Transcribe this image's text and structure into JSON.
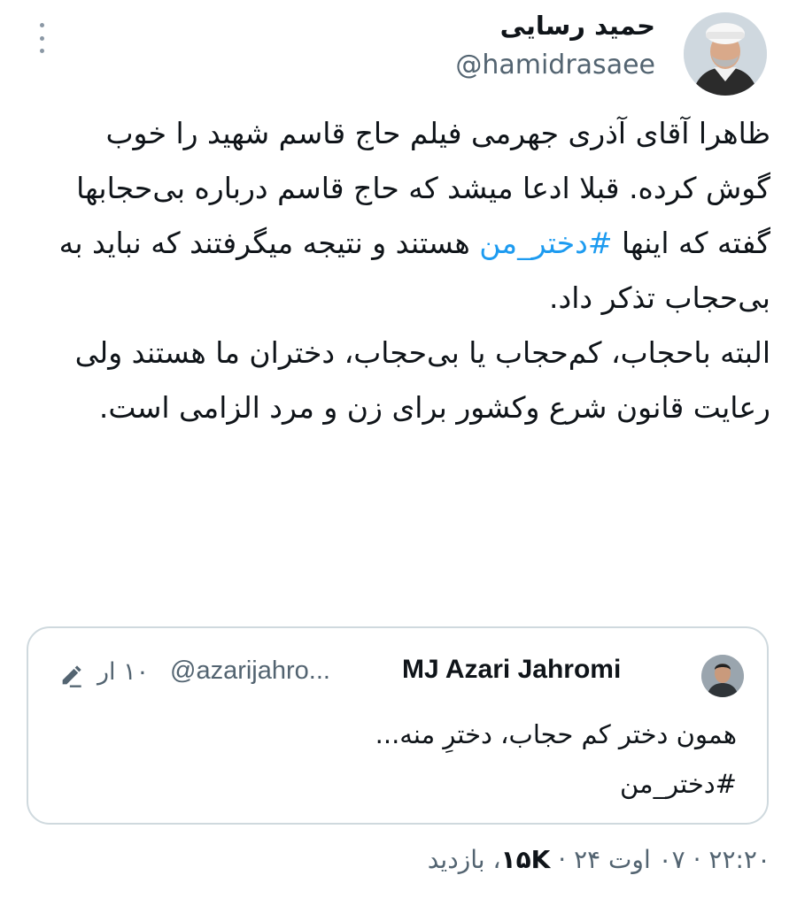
{
  "tweet": {
    "author_name": "حمید رسایی",
    "author_handle": "@hamidrasaee",
    "paragraph1_text": "ظاهرا آقای آذری جهرمی فیلم حاج قاسم شهید را خوب گوش کرده. قبلا ادعا میشد که حاج قاسم درباره بی‌حجابها گفته که اینها",
    "paragraph1_hashtag": "#دختر_من",
    "paragraph1_tail": "هستند و نتیجه میگرفتند که نباید به بی‌حجاب تذکر داد.",
    "paragraph2": "البته باحجاب، کم‌حجاب یا بی‌حجاب، دختران ما هستند ولی رعایت قانون شرع وکشور برای زن و مرد الزامی است.",
    "time": "۲۲:۲۰",
    "date": "۰۷ اوت ۲۴",
    "views_count": "۱۵K",
    "views_label": "بازدید"
  },
  "quoted": {
    "author_name": "MJ Azari Jahromi",
    "author_handle": "@azarijahro...",
    "time": "۱۰ ار",
    "text": "همون دختر کم حجاب، دخترِ منه...",
    "hashtag": "#دختر_من"
  },
  "icons": {
    "more": "more-vertical-icon",
    "edit": "pencil-edit-icon"
  },
  "colors": {
    "link": "#1d9bf0",
    "secondary_text": "#536471",
    "border": "#cfd9de"
  }
}
